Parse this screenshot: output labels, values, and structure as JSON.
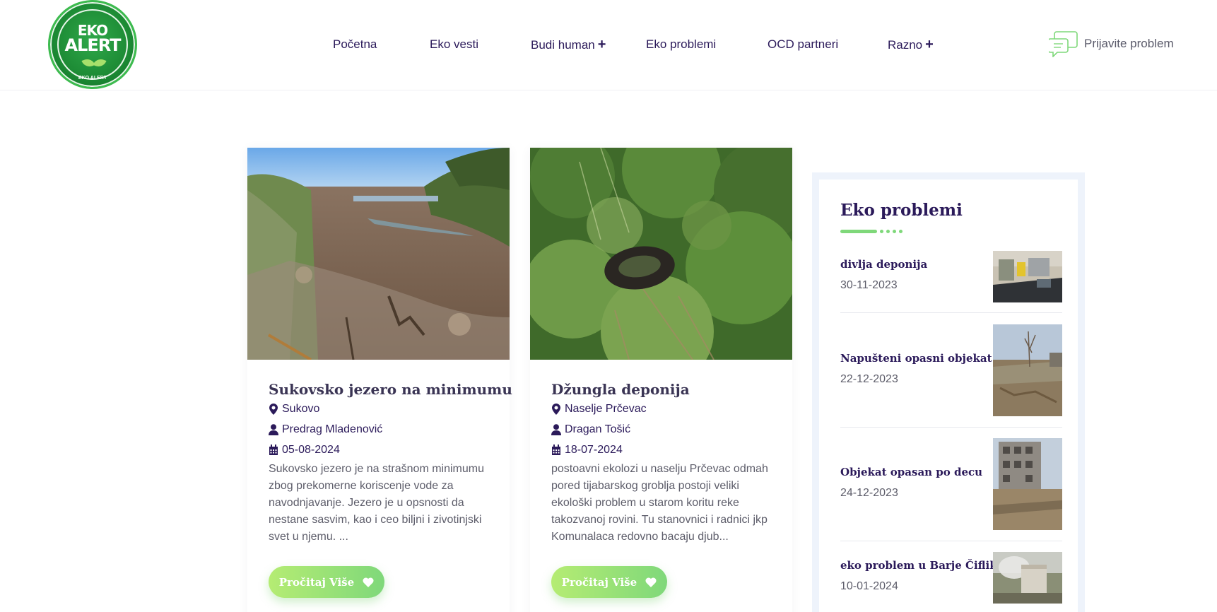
{
  "header": {
    "logo": {
      "top_text": "EKO",
      "bottom_text": "ALERT",
      "arc_text": "EKO ALERT"
    },
    "nav": [
      {
        "label": "Početna",
        "has_submenu": false
      },
      {
        "label": "Eko vesti",
        "has_submenu": false
      },
      {
        "label": "Budi human",
        "has_submenu": true
      },
      {
        "label": "Eko problemi",
        "has_submenu": false
      },
      {
        "label": "OCD partneri",
        "has_submenu": false
      },
      {
        "label": "Razno",
        "has_submenu": true
      }
    ],
    "submenu_glyph": "+",
    "report_label": "Prijavite problem",
    "report_icon": "chat-bubbles-icon"
  },
  "cards": [
    {
      "title": "Sukovsko jezero na minimumu",
      "location": "Sukovo",
      "author": "Predrag Mladenović",
      "date": "05-08-2024",
      "excerpt": "Sukovsko jezero je na strašnom minimumu zbog prekomerne koriscenje vode za navodnjavanje. Jezero je u opsnosti da nestane sasvim, kao i ceo biljni i zivotinjski svet u njemu. ...",
      "button": "Pročitaj Više"
    },
    {
      "title": "Džungla deponija",
      "location": "Naselje Prčevac",
      "author": "Dragan Tošić",
      "date": "18-07-2024",
      "excerpt": "postoavni ekolozi u naselju Prčevac odmah pored tijabarskog groblja postoji veliki ekološki problem u starom koritu reke takozvanoj rovini. Tu stanovnici i radnici jkp Komunalaca redovno bacaju djub...",
      "button": "Pročitaj Više"
    }
  ],
  "sidebar": {
    "title": "Eko problemi",
    "items": [
      {
        "title": "divlja deponija",
        "date": "30-11-2023"
      },
      {
        "title": "Napušteni opasni objekat",
        "date": "22-12-2023"
      },
      {
        "title": "Objekat opasan po decu",
        "date": "24-12-2023"
      },
      {
        "title": "eko problem u Barje Čiflik",
        "date": "10-01-2024"
      }
    ]
  },
  "colors": {
    "brand_purple": "#2b1a5a",
    "accent_green": "#7fd87a",
    "accent_green_light": "#b5ec73",
    "sidebar_bg": "#eef3fb"
  }
}
